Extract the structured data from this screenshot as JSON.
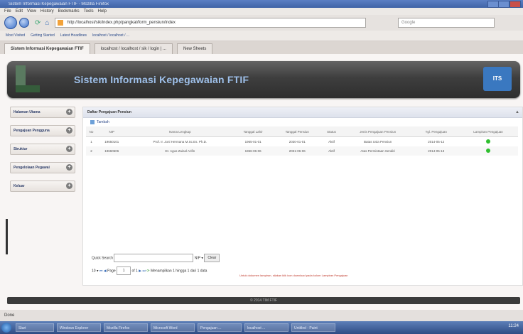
{
  "window": {
    "title": "Sistem Informasi Kepegawaian FTIF - Mozilla Firefox"
  },
  "menu": [
    "File",
    "Edit",
    "View",
    "History",
    "Bookmarks",
    "Tools",
    "Help"
  ],
  "nav": {
    "url": "http://localhost/sik/index.php/pangkat/form_pensiun/index",
    "search_placeholder": "Google"
  },
  "bookmarks": [
    "Most Visited",
    "Getting Started",
    "Latest Headlines",
    "localhost / localhost / ..."
  ],
  "tabs": [
    {
      "label": "Sistem Informasi Kepegawaian FTIF",
      "active": true
    },
    {
      "label": "localhost / localhost / sik / login | ...",
      "active": false
    },
    {
      "label": "New Sheets",
      "active": false
    }
  ],
  "banner": {
    "title": "Sistem Informasi Kepegawaian FTIF",
    "badge": "ITS"
  },
  "sidebar": {
    "items": [
      {
        "label": "Halaman Utama"
      },
      {
        "label": "Pengajuan Pengguna"
      },
      {
        "label": "Struktur"
      },
      {
        "label": "Pengelolaan Pegawai"
      },
      {
        "label": "Keluar"
      }
    ]
  },
  "panel": {
    "title": "Daftar Pengajuan Pensiun",
    "toolbar_label": "Tambah",
    "columns": [
      "No",
      "NIP",
      "Nama Lengkap",
      "Tanggal Lahir",
      "Tanggal Pensiun",
      "Status",
      "Jenis Pengajuan Pensiun",
      "Tgl. Pengajuan",
      "Lampiran Pengajuan"
    ],
    "rows": [
      {
        "cells": [
          "1",
          "19650101",
          "Prof. Ir. Joni Hermana M.Sc.Es. Ph.D.",
          "1965-01-01",
          "2030-01-01",
          "Aktif",
          "Batas Usia Pensiun",
          "2014-05-12"
        ],
        "status_color": "#2fbf2f"
      },
      {
        "cells": [
          "2",
          "19660606",
          "Dr. Agus Zainal Arifin",
          "1966-06-06",
          "2031-06-06",
          "Aktif",
          "Atas Permintaan Sendiri",
          "2014-05-13"
        ],
        "status_color": "#2fbf2f"
      }
    ]
  },
  "pager": {
    "search_label": "Quick Search",
    "search_field": "NIP",
    "clear_label": "Clear",
    "per_page": "10",
    "page_label": "Page",
    "page_value": "1",
    "of_label": "of 1",
    "info": "Menampilkan 1 hingga 1 dari 1 data"
  },
  "note": "Untuk dokumen lampiran, silakan klik icon download pada kolom Lampiran Pengajuan",
  "footer": "© 2014 TIM FTIF",
  "statusbar": "Done",
  "taskbar": {
    "buttons": [
      "Start",
      "Windows Explorer",
      "Mozilla Firefox",
      "Microsoft Word",
      "Pengajuan ...",
      "localhost ...",
      "Untitled - Paint"
    ],
    "clock": "11:24"
  }
}
